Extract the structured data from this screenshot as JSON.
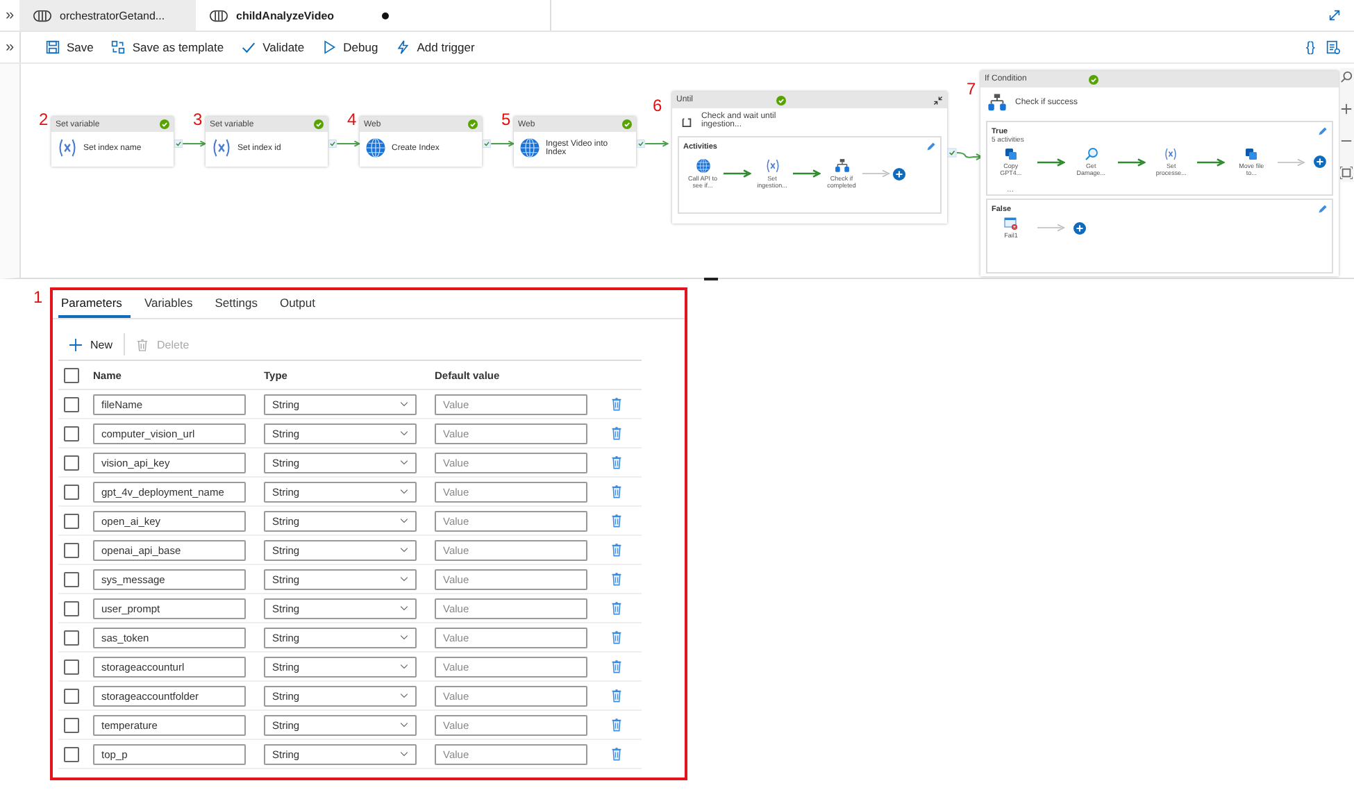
{
  "tab_bar": {
    "collapse": "»",
    "tabs": [
      {
        "label": "orchestratorGetand...",
        "selected": false,
        "unsaved": false
      },
      {
        "label": "childAnalyzeVideo",
        "selected": true,
        "unsaved": true
      }
    ]
  },
  "toolbar": {
    "collapse": "»",
    "actions": [
      {
        "kind": "save",
        "label": "Save"
      },
      {
        "kind": "template",
        "label": "Save as template"
      },
      {
        "kind": "validate",
        "label": "Validate"
      },
      {
        "kind": "debug",
        "label": "Debug"
      },
      {
        "kind": "trigger",
        "label": "Add trigger"
      }
    ],
    "code_glyph": "{}"
  },
  "canvas": {
    "activities": [
      {
        "marker": "2",
        "category": "Set variable",
        "title": "Set index name",
        "kind": "variable",
        "succeeded": true
      },
      {
        "marker": "3",
        "category": "Set variable",
        "title": "Set index id",
        "kind": "variable",
        "succeeded": true
      },
      {
        "marker": "4",
        "category": "Web",
        "title": "Create Index",
        "kind": "web",
        "succeeded": true
      },
      {
        "marker": "5",
        "category": "Web",
        "title": "Ingest Video into Index",
        "kind": "web",
        "succeeded": true
      }
    ],
    "until": {
      "marker": "6",
      "category": "Until",
      "title": "Check and wait until ingestion...",
      "succeeded": true,
      "section": "Activities",
      "steps": [
        {
          "kind": "web",
          "label": "Call API to see if..."
        },
        {
          "kind": "variable",
          "label": "Set ingestion..."
        },
        {
          "kind": "condition",
          "label": "Check if completed"
        }
      ]
    },
    "if_condition": {
      "marker": "7",
      "category": "If Condition",
      "title": "Check if success",
      "succeeded": true,
      "branches": [
        {
          "label": "True",
          "count": "5 activities",
          "more": "...",
          "steps": [
            {
              "kind": "copy",
              "label": "Copy GPT4..."
            },
            {
              "kind": "lookup",
              "label": "Get Damage..."
            },
            {
              "kind": "variable",
              "label": "Set processe..."
            },
            {
              "kind": "copy",
              "label": "Move file to..."
            }
          ]
        },
        {
          "label": "False",
          "steps": [
            {
              "kind": "fail",
              "label": "Fail1"
            }
          ]
        }
      ]
    }
  },
  "panel": {
    "marker": "1",
    "tabs": [
      {
        "label": "Parameters",
        "selected": true
      },
      {
        "label": "Variables",
        "selected": false
      },
      {
        "label": "Settings",
        "selected": false
      },
      {
        "label": "Output",
        "selected": false
      }
    ],
    "new_label": "New",
    "delete": {
      "label": "Delete",
      "disabled": true
    },
    "columns": [
      "Name",
      "Type",
      "Default value"
    ],
    "select_all": false,
    "rows": [
      {
        "name": "fileName",
        "type": "String",
        "placeholder": "Value",
        "checked": false
      },
      {
        "name": "computer_vision_url",
        "type": "String",
        "placeholder": "Value",
        "checked": false
      },
      {
        "name": "vision_api_key",
        "type": "String",
        "placeholder": "Value",
        "checked": false
      },
      {
        "name": "gpt_4v_deployment_name",
        "type": "String",
        "placeholder": "Value",
        "checked": false
      },
      {
        "name": "open_ai_key",
        "type": "String",
        "placeholder": "Value",
        "checked": false
      },
      {
        "name": "openai_api_base",
        "type": "String",
        "placeholder": "Value",
        "checked": false
      },
      {
        "name": "sys_message",
        "type": "String",
        "placeholder": "Value",
        "checked": false
      },
      {
        "name": "user_prompt",
        "type": "String",
        "placeholder": "Value",
        "checked": false
      },
      {
        "name": "sas_token",
        "type": "String",
        "placeholder": "Value",
        "checked": false
      },
      {
        "name": "storageaccounturl",
        "type": "String",
        "placeholder": "Value",
        "checked": false
      },
      {
        "name": "storageaccountfolder",
        "type": "String",
        "placeholder": "Value",
        "checked": false
      },
      {
        "name": "temperature",
        "type": "String",
        "placeholder": "Value",
        "checked": false
      },
      {
        "name": "top_p",
        "type": "String",
        "placeholder": "Value",
        "checked": false
      }
    ]
  }
}
